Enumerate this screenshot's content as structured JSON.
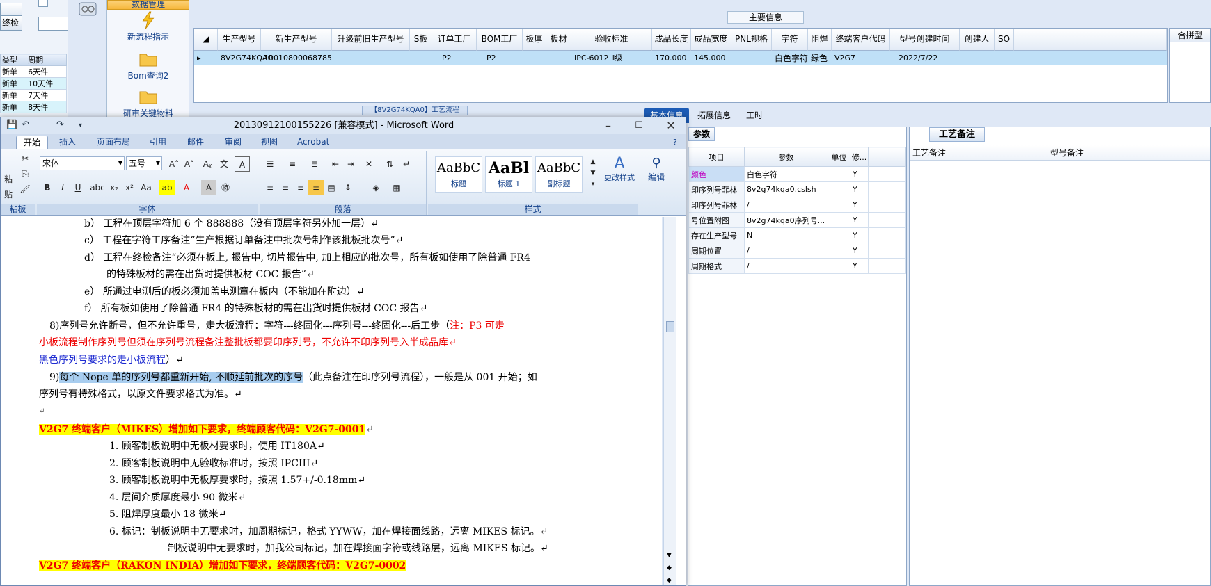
{
  "bg_left": {
    "btn1": "",
    "btn2": "终检",
    "table_headers": [
      "类型",
      "周期"
    ],
    "table_rows": [
      [
        "新单",
        "6天件"
      ],
      [
        "新单",
        "10天件"
      ],
      [
        "新单",
        "7天件"
      ],
      [
        "新单",
        "8天件"
      ]
    ]
  },
  "nav_panel": {
    "top_label": "数据管理",
    "items": [
      "新流程指示",
      "Bom查询2",
      "研审关键物料"
    ]
  },
  "main_info": {
    "title": "主要信息",
    "columns": [
      "生产型号",
      "新生产型号",
      "升级前旧生产型号",
      "S板",
      "订单工厂",
      "BOM工厂",
      "板厚",
      "板材",
      "验收标准",
      "成品长度",
      "成品宽度",
      "PNL规格",
      "字符",
      "阻焊",
      "终端客户代码",
      "型号创建时间",
      "创建人",
      "SO"
    ],
    "row": [
      "8V2G74KQA0",
      "10010800068785",
      "",
      "",
      "P2",
      "P2",
      "",
      "",
      "IPC-6012 Ⅱ级",
      "170.000",
      "145.000",
      "",
      "白色字符",
      "绿色",
      "V2G7",
      "2022/7/22",
      "",
      ""
    ],
    "right_header": "合拼型"
  },
  "workflow_tab": "【8V2G74KQA0】工艺流程",
  "detail_tabs": [
    "基本信息",
    "拓展信息",
    "工时"
  ],
  "params": {
    "tab": "参数",
    "headers": [
      "项目",
      "参数",
      "单位",
      "修..."
    ],
    "rows": [
      [
        "颜色",
        "白色字符",
        "",
        "Y"
      ],
      [
        "印序列号菲林",
        "8v2g74kqa0.cslsh",
        "",
        "Y"
      ],
      [
        "印序列号菲林",
        "/",
        "",
        "Y"
      ],
      [
        "号位置附图",
        "8v2g74kqa0序列号...",
        "",
        "Y"
      ],
      [
        "存在生产型号",
        "N",
        "",
        "Y"
      ],
      [
        "周期位置",
        "/",
        "",
        "Y"
      ],
      [
        "周期格式",
        "/",
        "",
        "Y"
      ]
    ]
  },
  "craft": {
    "tab": "工艺备注",
    "col1": "工艺备注",
    "col2": "型号备注"
  },
  "word": {
    "title": "20130912100155226 [兼容模式] - Microsoft Word",
    "tabs": [
      "开始",
      "插入",
      "页面布局",
      "引用",
      "邮件",
      "审阅",
      "视图",
      "Acrobat"
    ],
    "font_name": "宋体",
    "font_size": "五号",
    "group_labels": [
      "粘板",
      "字体",
      "段落",
      "样式"
    ],
    "styles": [
      {
        "sample": "AaBbC",
        "name": "标题"
      },
      {
        "sample": "AaBl",
        "name": "标题 1"
      },
      {
        "sample": "AaBbC",
        "name": "副标题"
      }
    ],
    "change_styles": "更改样式",
    "edit": "编辑",
    "paste": "粘贴",
    "lines": {
      "b": "b） 工程在顶层字符加 6 个 888888（没有顶层字符另外加一层）↵",
      "c": "c） 工程在字符工序备注“生产根据订单备注中批次号制作该批板批次号”↵",
      "d1": "d） 工程在终检备注“必须在板上, 报告中, 切片报告中, 加上相应的批次号，所有板如使用了除普通 FR4",
      "d2": "的特殊板材的需在出货时提供板材 COC 报告”↵",
      "e": "e） 所通过电测后的板必须加盖电测章在板内（不能加在附边）↵",
      "f": "f） 所有板如使用了除普通 FR4 的特殊板材的需在出货时提供板材 COC 报告↵",
      "p8_a": "8)序列号允许断号，但不允许重号，走大板流程：字符---终固化---序列号---终固化---后工步（",
      "p8_b": "注：P3 可走",
      "p8_c": "小板流程制作序列号但须在序列号流程备注整批板都要印序列号，不允许不印序列号入半成品库↵",
      "p8_d": "黑色序列号要求的走小板流程",
      "p8_e": "）↵",
      "p9_num": "9)",
      "p9_sel": "每个 Nope 单的序列号都重新开始, 不顺延前批次的序号",
      "p9_rest": "（此点备注在印序列号流程），一般是从 001 开始；如",
      "p9_2": "序列号有特殊格式，以原文件要求格式为准。↵",
      "blank": "↵",
      "v2g7_1": "V2G7 终端客户（MIKES）增加如下要求，终端顾客代码：V2G7-0001",
      "n1": "1.    顾客制板说明中无板材要求时，使用 IT180A↵",
      "n2": "2.    顾客制板说明中无验收标准时，按照 IPCIII↵",
      "n3": "3.    顾客制板说明中无板厚要求时，按照 1.57+/-0.18mm↵",
      "n4": "4.    层间介质厚度最小 90 微米↵",
      "n5": "5.    阻焊厚度最小 18 微米↵",
      "n6": "6.    标记：制板说明中无要求时，加周期标记，格式 YYWW，加在焊接面线路，远离 MIKES 标记。↵",
      "n6b": "制板说明中无要求时，加我公司标记，加在焊接面字符或线路层，远离 MIKES 标记。↵",
      "v2g7_2": "V2G7 终端客户（RAKON INDIA）增加如下要求，终端顾客代码：V2G7-0002"
    }
  }
}
